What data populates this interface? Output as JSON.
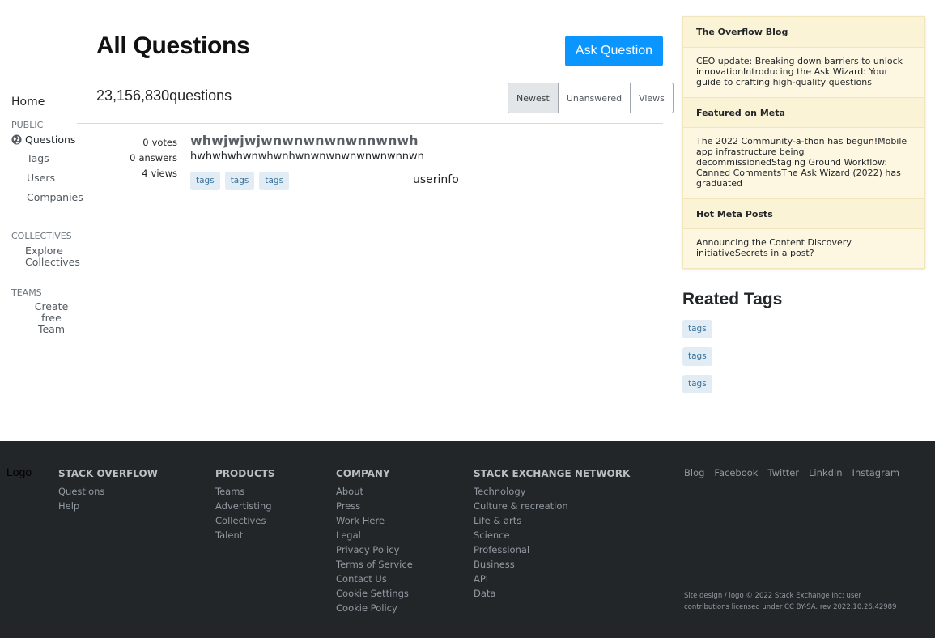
{
  "nav": {
    "home": "Home",
    "public_label": "PUBLIC",
    "questions": "Questions",
    "tags": "Tags",
    "users": "Users",
    "companies": "Companies",
    "collectives_label": "COLLECTIVES",
    "explore_collectives_1": "Explore",
    "explore_collectives_2": "Collectives",
    "teams_label": "TEAMS",
    "create_team_1": "Create free",
    "create_team_2": "Team"
  },
  "header": {
    "title": "All Questions",
    "ask_button": "Ask Question",
    "question_count": "23,156,830",
    "question_count_suffix": "questions",
    "filters": [
      "Newest",
      "Unanswered",
      "Views"
    ]
  },
  "question": {
    "votes": "0",
    "votes_label": "votes",
    "answers": "0",
    "answers_label": "answers",
    "views": "4",
    "views_label": "views",
    "title": "whwjwjwjwnwnwnwnwnnwnwh",
    "excerpt": "hwhwhwhwnwhwnhwnwnwnwnwnwnwnnwn",
    "tags": [
      "tags",
      "tags",
      "tags"
    ],
    "userinfo": "userinfo"
  },
  "sidebar": {
    "blog_head": "The Overflow Blog",
    "blog_body": "CEO update: Breaking down barriers to unlock innovationIntroducing the Ask Wizard: Your guide to crafting high-quality questions",
    "meta_head": "Featured on Meta",
    "meta_body": "The 2022 Community-a-thon has begun!Mobile app infrastructure being decommissionedStaging Ground Workflow: Canned CommentsThe Ask Wizard (2022) has graduated",
    "hot_head": "Hot Meta Posts",
    "hot_body": "Announcing the Content Discovery initiativeSecrets in a post?",
    "related_title": "Reated Tags",
    "related_tags": [
      "tags",
      "tags",
      "tags"
    ]
  },
  "footer": {
    "logo": "Logo",
    "so_head": "STACK OVERFLOW",
    "so_links": [
      "Questions",
      "Help"
    ],
    "products_head": "PRODUCTS",
    "products_links": [
      "Teams",
      "Advertisting",
      "Collectives",
      "Talent"
    ],
    "company_head": "COMPANY",
    "company_links": [
      "About",
      "Press",
      "Work Here",
      "Legal",
      "Privacy Policy",
      "Terms of Service",
      "Contact Us",
      "Cookie Settings",
      "Cookie Policy"
    ],
    "network_head": "STACK EXCHANGE NETWORK",
    "network_links": [
      "Technology",
      "Culture & recreation",
      "Life & arts",
      "Science",
      "Professional",
      "Business",
      "API",
      "Data"
    ],
    "social": [
      "Blog",
      "Facebook",
      "Twitter",
      "LinkdIn",
      "Instagram"
    ],
    "copyright": "Site design / logo © 2022 Stack Exchange Inc; user contributions licensed under CC BY-SA. rev 2022.10.26.42989"
  },
  "colors": {
    "accent": "#0a95ff",
    "footer_bg": "#232629",
    "tag_bg": "#e1ecf4",
    "tag_fg": "#39739d",
    "sidebar_bg": "#fdf7e2"
  }
}
